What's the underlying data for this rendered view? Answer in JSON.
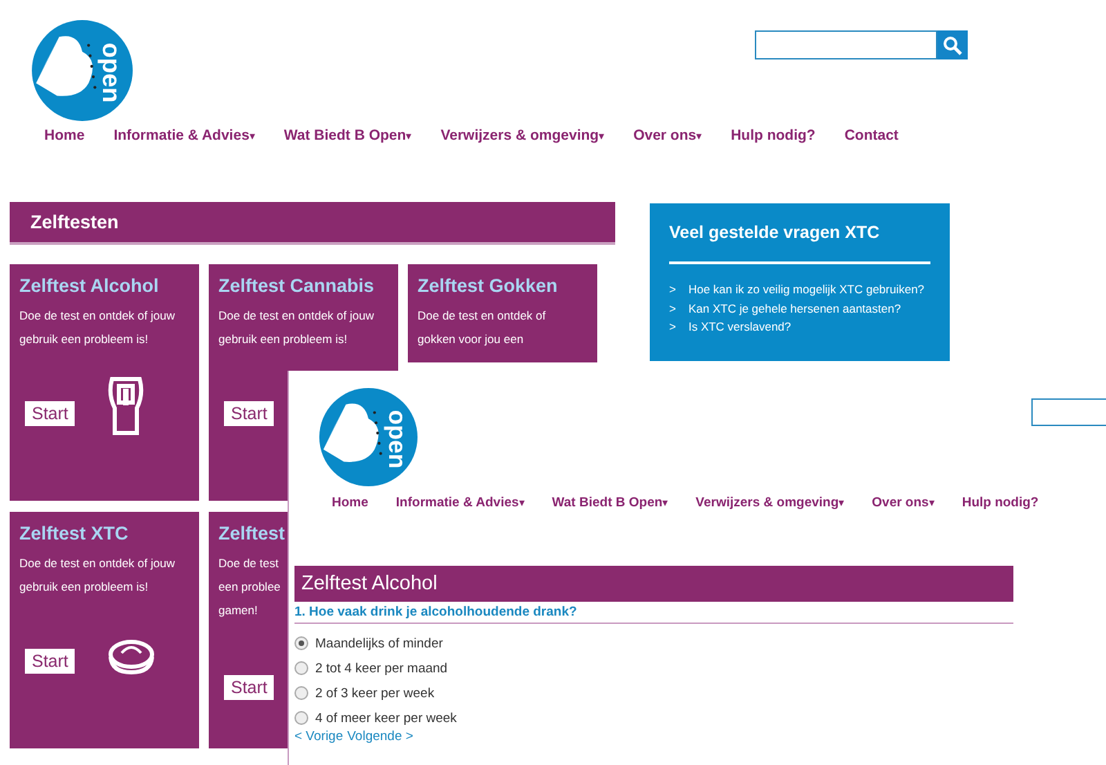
{
  "header": {
    "logo_text": "open"
  },
  "nav": [
    {
      "label": "Home"
    },
    {
      "label": "Informatie & Advies",
      "caret": "▾"
    },
    {
      "label": "Wat Biedt B Open",
      "caret": "▾"
    },
    {
      "label": "Verwijzers & omgeving",
      "caret": "▾"
    },
    {
      "label": "Over ons",
      "caret": "▾"
    },
    {
      "label": "Hulp nodig?"
    },
    {
      "label": "Contact"
    }
  ],
  "section_title": "Zelftesten",
  "cards": [
    {
      "title": "Zelftest Alcohol",
      "lines": [
        "Doe de test en ontdek of jouw",
        "gebruik een probleem is!"
      ],
      "button": "Start",
      "kind": "glass"
    },
    {
      "title": "Zelftest Cannabis",
      "lines": [
        "Doe de test en ontdek of jouw",
        "gebruik een probleem is!"
      ],
      "button": "Start",
      "kind": "plain"
    },
    {
      "title": "Zelftest Gokken",
      "lines": [
        "Doe de test en ontdek of",
        "gokken voor jou een"
      ],
      "kind": "plain"
    },
    {
      "title": "Zelftest XTC",
      "lines": [
        "Doe de test en ontdek of jouw",
        "gebruik een probleem is!"
      ],
      "button": "Start",
      "kind": "pill"
    },
    {
      "title": "Zelftest",
      "lines": [
        "Doe de test",
        "een problee",
        "gamen!"
      ],
      "button": "Start",
      "kind": "plain"
    }
  ],
  "faq": {
    "title": "Veel gestelde vragen XTC",
    "items": [
      {
        "bullet": ">",
        "text": "Hoe kan ik zo veilig mogelijk XTC gebruiken?"
      },
      {
        "bullet": ">",
        "text": "Kan XTC je gehele hersenen aantasten?"
      },
      {
        "bullet": ">",
        "text": "Is XTC verslavend?"
      }
    ]
  },
  "overlay": {
    "logo_text": "open",
    "nav": [
      {
        "label": "Home"
      },
      {
        "label": "Informatie & Advies",
        "caret": "▾"
      },
      {
        "label": "Wat Biedt B Open",
        "caret": "▾"
      },
      {
        "label": "Verwijzers & omgeving",
        "caret": "▾"
      },
      {
        "label": "Over ons",
        "caret": "▾"
      },
      {
        "label": "Hulp nodig?"
      }
    ],
    "test_title": "Zelftest Alcohol",
    "question": "1. Hoe vaak drink je alcoholhoudende drank?",
    "options": [
      {
        "label": "Maandelijks of minder",
        "selected": true
      },
      {
        "label": "2 tot 4 keer per maand",
        "selected": false
      },
      {
        "label": "2 of 3 keer per week",
        "selected": false
      },
      {
        "label": "4 of meer keer per week",
        "selected": false
      }
    ],
    "prev": "< Vorige",
    "next": "Volgende >"
  }
}
